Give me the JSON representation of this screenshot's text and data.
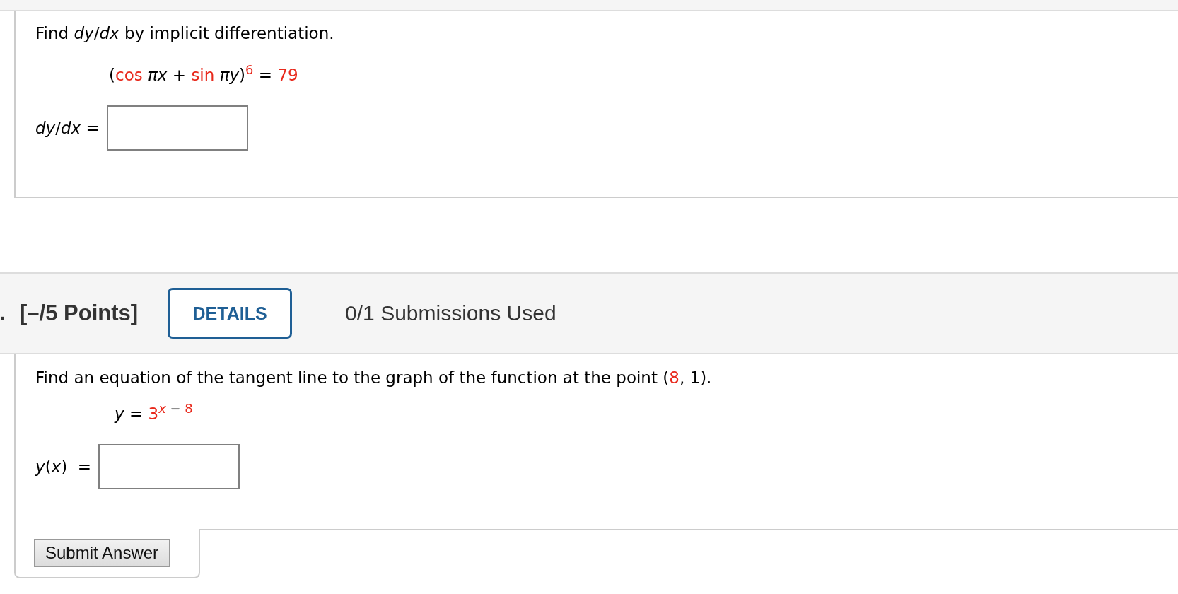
{
  "question1": {
    "prompt": [
      {
        "text": "Find *dy*/*dx* by implicit differentiation.",
        "highlight": false
      }
    ],
    "equation": [
      {
        "text": "(",
        "highlight": false
      },
      {
        "text": "cos",
        "highlight": true
      },
      {
        "text": " *πx* + ",
        "highlight": false
      },
      {
        "text": "sin",
        "highlight": true
      },
      {
        "text": " *πy*)",
        "highlight": false
      },
      {
        "text": "6",
        "highlight": true,
        "kind": "superscript"
      },
      {
        "text": " = ",
        "highlight": false
      },
      {
        "text": "79",
        "highlight": true
      }
    ],
    "answer": {
      "label": "*dy*/*dx* ="
    }
  },
  "question2": {
    "number": ".",
    "points": "[–/5 Points]",
    "details_button": "DETAILS",
    "submissions": "0/1 Submissions Used",
    "prompt": [
      {
        "text": "Find an equation of the tangent line to the graph of the function at the point (",
        "highlight": false
      },
      {
        "text": "8",
        "highlight": true
      },
      {
        "text": ", 1).",
        "highlight": false
      }
    ],
    "equation": [
      {
        "text": "*y* = ",
        "highlight": false
      },
      {
        "text": "3",
        "highlight": true
      },
      {
        "text": "*x*",
        "highlight": true,
        "kind": "superscript"
      },
      {
        "text": " − ",
        "highlight": false,
        "kind": "superscript"
      },
      {
        "text": "8",
        "highlight": true,
        "kind": "superscript"
      }
    ],
    "answer": {
      "label": "*y*(*x*)  ="
    },
    "submit_button": "Submit Answer"
  }
}
